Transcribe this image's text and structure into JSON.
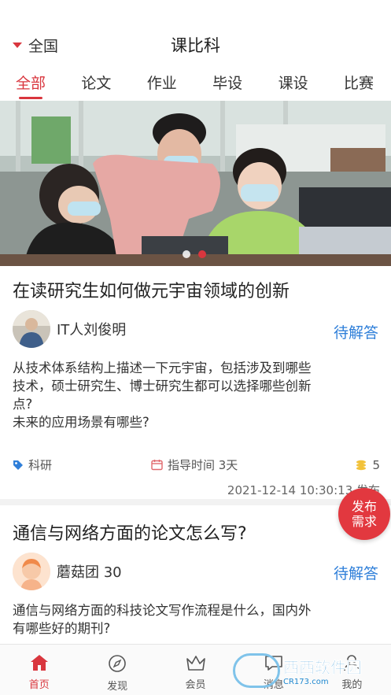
{
  "header": {
    "region_label": "全国",
    "title": "课比科"
  },
  "tabs": [
    {
      "label": "全部",
      "active": true
    },
    {
      "label": "论文",
      "active": false
    },
    {
      "label": "作业",
      "active": false
    },
    {
      "label": "毕设",
      "active": false
    },
    {
      "label": "课设",
      "active": false
    },
    {
      "label": "比赛",
      "active": false
    }
  ],
  "banner": {
    "slide_count": 2,
    "active_slide": 2
  },
  "posts": [
    {
      "title": "在读研究生如何做元宇宙领域的创新",
      "author": "IT人刘俊明",
      "status": "待解答",
      "description_lines": [
        "从技术体系结构上描述一下元宇宙，包括涉及到哪些",
        "技术，硕士研究生、博士研究生都可以选择哪些创新",
        "点?",
        "未来的应用场景有哪些?"
      ],
      "tag": "科研",
      "guide_time": "指导时间 3天",
      "coins": "5",
      "date": "2021-12-14 10:30:13 发布"
    },
    {
      "title": "通信与网络方面的论文怎么写?",
      "author": "蘑菇团 30",
      "status": "待解答",
      "description_lines": [
        "通信与网络方面的科技论文写作流程是什么，国内外",
        "有哪些好的期刊?"
      ]
    }
  ],
  "fab": {
    "line1": "发布",
    "line2": "需求"
  },
  "tabbar": [
    {
      "label": "首页",
      "icon": "home-icon",
      "active": true
    },
    {
      "label": "发现",
      "icon": "compass-icon",
      "active": false
    },
    {
      "label": "会员",
      "icon": "crown-icon",
      "active": false
    },
    {
      "label": "消息",
      "icon": "message-icon",
      "active": false
    },
    {
      "label": "我的",
      "icon": "user-icon",
      "active": false
    }
  ],
  "watermark": {
    "brand": "西西软件园",
    "url": "CR173.com"
  },
  "colors": {
    "accent": "#d9363e",
    "status_blue": "#2f7fd9"
  }
}
